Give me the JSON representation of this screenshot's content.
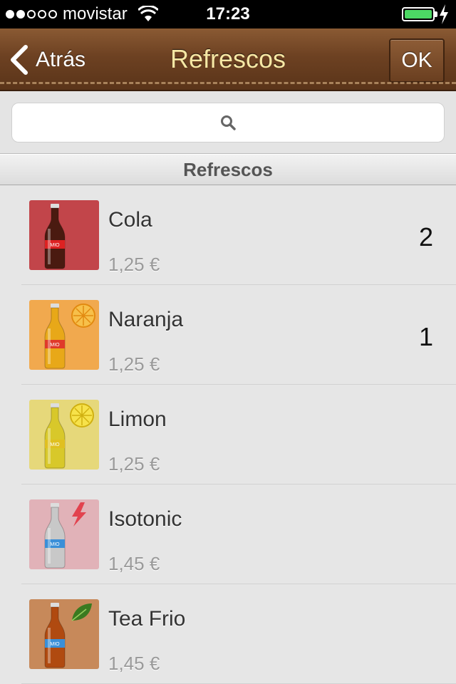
{
  "status": {
    "carrier": "movistar",
    "time": "17:23",
    "battery_level": 1.0,
    "signal_bars": 2,
    "signal_total": 5
  },
  "nav": {
    "back_label": "Atrás",
    "title": "Refrescos",
    "ok_label": "OK"
  },
  "search": {
    "placeholder": ""
  },
  "section": {
    "title": "Refrescos"
  },
  "items": [
    {
      "name": "Cola",
      "price": "1,25 €",
      "qty": "2",
      "bg": "#c2454a",
      "bottle": "#4a1a10",
      "label": "#d22",
      "badge": "none"
    },
    {
      "name": "Naranja",
      "price": "1,25 €",
      "qty": "1",
      "bg": "#f1a94e",
      "bottle": "#e8a818",
      "label": "#e03a2a",
      "badge": "orange-icon"
    },
    {
      "name": "Limon",
      "price": "1,25 €",
      "qty": "",
      "bg": "#e6d87a",
      "bottle": "#d8c82a",
      "label": "#e0c020",
      "badge": "lemon-icon"
    },
    {
      "name": "Isotonic",
      "price": "1,45 €",
      "qty": "",
      "bg": "#e1b2b8",
      "bottle": "#c8c8c8",
      "label": "#3a8fd8",
      "badge": "lightning-icon"
    },
    {
      "name": "Tea Frio",
      "price": "1,45 €",
      "qty": "",
      "bg": "#c7895a",
      "bottle": "#b04a10",
      "label": "#3a8fd8",
      "badge": "leaf-icon"
    }
  ]
}
